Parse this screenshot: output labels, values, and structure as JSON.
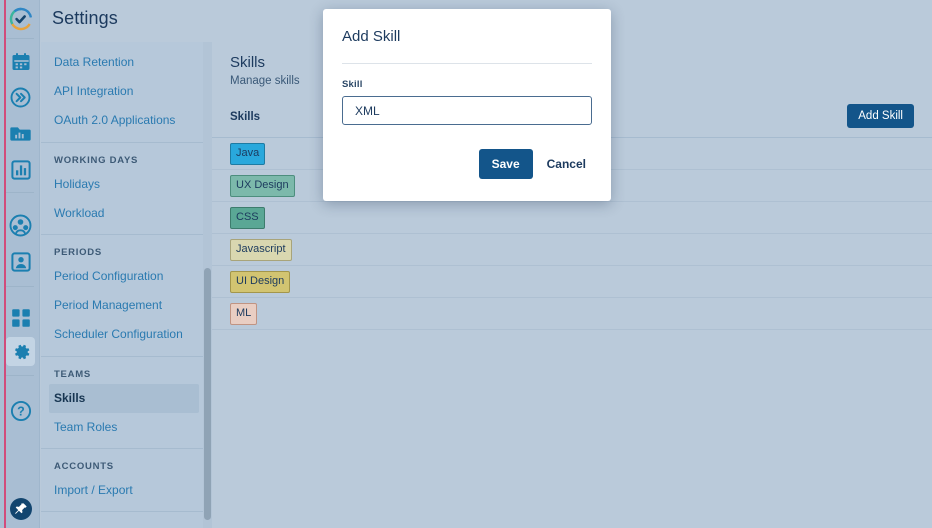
{
  "app": {
    "title": "Settings",
    "accent_color": "#13558a",
    "rail_accent_color": "#d8386b"
  },
  "icon_rail": {
    "items": [
      {
        "name": "app-logo-icon",
        "glyph": "logo"
      },
      {
        "name": "calendar-icon",
        "glyph": "calendar"
      },
      {
        "name": "fast-forward-icon",
        "glyph": "chevrons"
      },
      {
        "name": "reports-folder-icon",
        "glyph": "folder-chart"
      },
      {
        "name": "bar-chart-icon",
        "glyph": "bar-chart"
      },
      {
        "name": "team-icon",
        "glyph": "people"
      },
      {
        "name": "person-icon",
        "glyph": "person"
      },
      {
        "name": "grid-apps-icon",
        "glyph": "grid"
      },
      {
        "name": "settings-gear-icon",
        "glyph": "gear",
        "active": true
      },
      {
        "name": "help-icon",
        "glyph": "question"
      },
      {
        "name": "pin-icon",
        "glyph": "pin"
      }
    ]
  },
  "settings_nav": {
    "groups": [
      {
        "caption": "",
        "items": [
          {
            "label": "Data Retention",
            "selected": false
          },
          {
            "label": "API Integration",
            "selected": false
          },
          {
            "label": "OAuth 2.0 Applications",
            "selected": false
          }
        ]
      },
      {
        "caption": "WORKING DAYS",
        "items": [
          {
            "label": "Holidays",
            "selected": false
          },
          {
            "label": "Workload",
            "selected": false
          }
        ]
      },
      {
        "caption": "PERIODS",
        "items": [
          {
            "label": "Period Configuration",
            "selected": false
          },
          {
            "label": "Period Management",
            "selected": false
          },
          {
            "label": "Scheduler Configuration",
            "selected": false
          }
        ]
      },
      {
        "caption": "TEAMS",
        "items": [
          {
            "label": "Skills",
            "selected": true
          },
          {
            "label": "Team Roles",
            "selected": false
          }
        ]
      },
      {
        "caption": "ACCOUNTS",
        "items": [
          {
            "label": "Import / Export",
            "selected": false
          }
        ]
      }
    ]
  },
  "page": {
    "title": "Skills",
    "subtitle": "Manage skills",
    "column_header": "Skills",
    "add_button_label": "Add Skill"
  },
  "skills": [
    {
      "label": "Java",
      "bg": "#29a8dc",
      "border": "#1d7ba3"
    },
    {
      "label": "UX Design",
      "bg": "#7cb9ab",
      "border": "#4d8e7e"
    },
    {
      "label": "CSS",
      "bg": "#5aa795",
      "border": "#3d7c6d"
    },
    {
      "label": "Javascript",
      "bg": "#d9d7b0",
      "border": "#a8a47a"
    },
    {
      "label": "UI Design",
      "bg": "#d2c471",
      "border": "#a3964b"
    },
    {
      "label": "ML",
      "bg": "#e9cec3",
      "border": "#c09483"
    }
  ],
  "modal": {
    "title": "Add Skill",
    "field_label": "Skill",
    "field_value": "XML",
    "field_placeholder": "",
    "save_label": "Save",
    "cancel_label": "Cancel"
  }
}
